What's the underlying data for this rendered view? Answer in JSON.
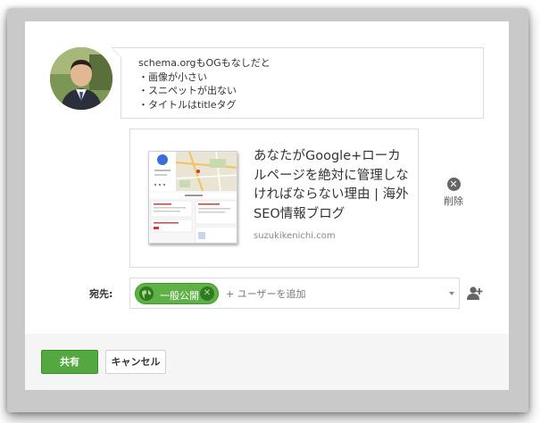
{
  "post": {
    "lines": [
      "schema.orgもOGもなしだと",
      "・画像が小さい",
      "・スニペットが出ない",
      "・タイトルはtitleタグ"
    ]
  },
  "link_preview": {
    "title": "あなたがGoogle+ローカルページを絶対に管理しなければならない理由 | 海外SEO情報ブログ",
    "domain": "suzukikenichi.com",
    "delete_label": "削除",
    "delete_icon": "close-circle-icon"
  },
  "share_to": {
    "label": "宛先:",
    "chip_label": "一般公開",
    "chip_icon": "globe-icon",
    "add_placeholder": "+ ユーザーを追加"
  },
  "buttons": {
    "share": "共有",
    "cancel": "キャンセル"
  },
  "colors": {
    "share_green": "#53a93f",
    "chip_green": "#5fb145"
  }
}
